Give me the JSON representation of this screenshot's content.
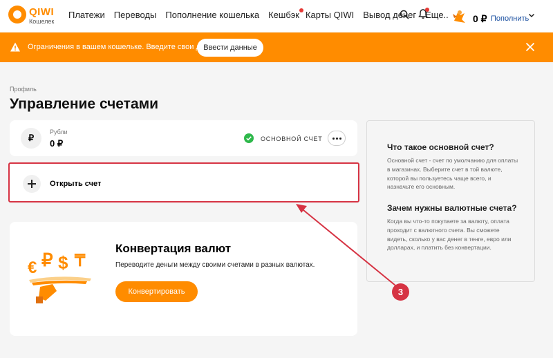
{
  "header": {
    "logo_text": "QIWI",
    "logo_sub": "Кошелек",
    "nav": [
      "Платежи",
      "Переводы",
      "Пополнение кошелька",
      "Кешбэк",
      "Карты QIWI",
      "Вывод денег",
      "Еще..."
    ],
    "balance": "0 ₽",
    "topup_label": "Пополнить"
  },
  "banner": {
    "text": "Ограничения в вашем кошельке. Введите свои данные!",
    "button_label": "Ввести данные"
  },
  "page": {
    "breadcrumb": "Профиль",
    "title": "Управление счетами"
  },
  "account": {
    "currency_symbol": "₽",
    "label": "Рубли",
    "amount": "0 ₽",
    "main_label": "ОСНОВНОЙ СЧЕТ"
  },
  "open_account": {
    "label": "Открыть счет"
  },
  "convert": {
    "title": "Конвертация валют",
    "description": "Переводите деньги между своими счетами в разных валютах.",
    "button_label": "Конвертировать"
  },
  "info": {
    "heading1": "Что такое основной счет?",
    "text1": "Основной счет - счет по умолчанию для оплаты в магазинах. Выберите счет в той валюте, которой вы пользуетесь чаще всего, и назначьте его основным.",
    "heading2": "Зачем нужны валютные счета?",
    "text2": "Когда вы что-то покупаете за валюту, оплата проходит с валютного счета. Вы сможете видеть, сколько у вас денег в тенге, евро или долларах, и платить без конвертации."
  },
  "annotation": {
    "step": "3"
  },
  "colors": {
    "brand": "#ff8c00",
    "highlight": "#d63343",
    "success": "#2eb84b",
    "link": "#1a4fa0"
  }
}
